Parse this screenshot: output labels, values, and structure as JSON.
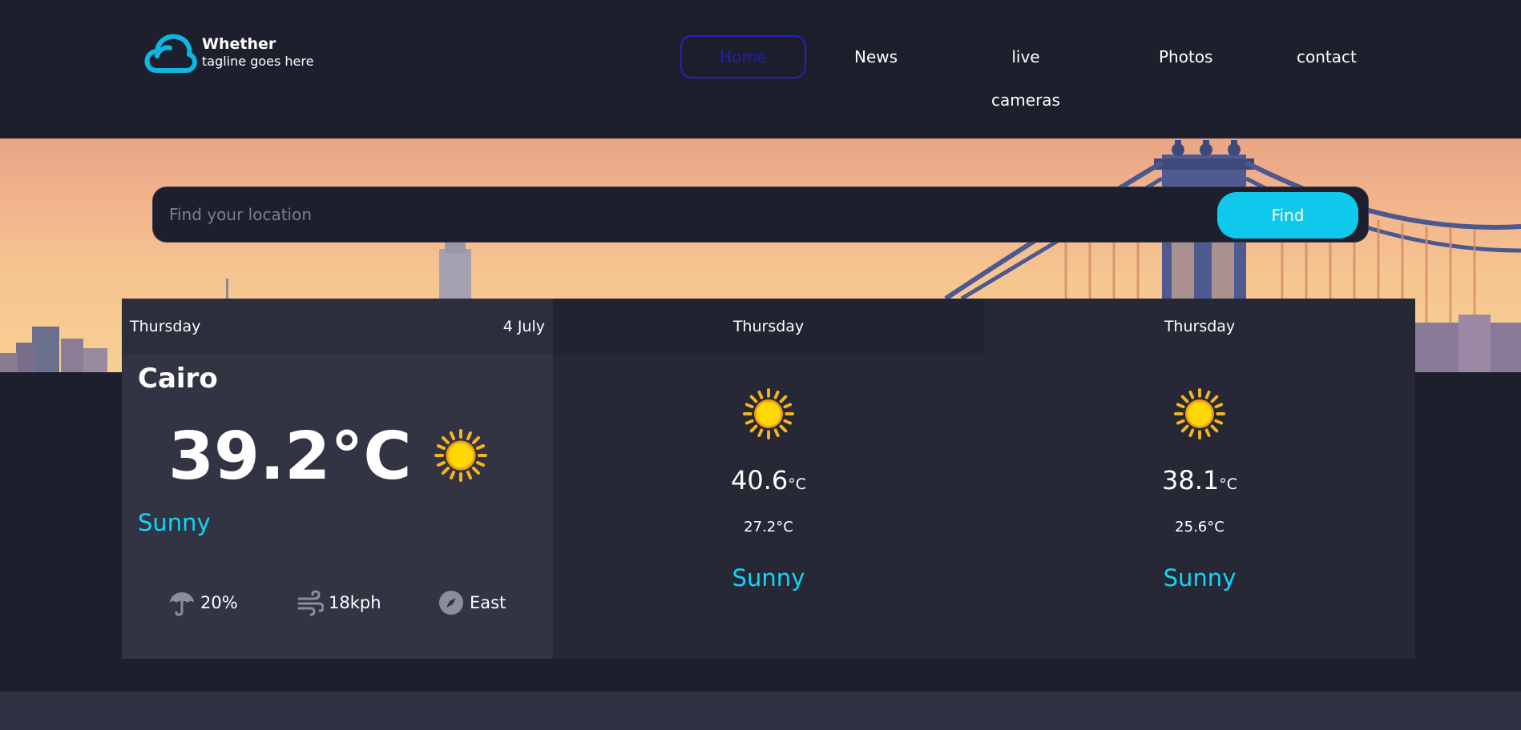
{
  "brand": {
    "name": "Whether",
    "tagline": "tagline goes here",
    "logo_icon": "cloud-icon",
    "logo_color": "#0fb6e0"
  },
  "nav": {
    "items": [
      "Home",
      "News",
      "live cameras",
      "Photos",
      "contact"
    ],
    "active": "Home",
    "active_color": "#1d25c4"
  },
  "search": {
    "placeholder": "Find your location",
    "value": "",
    "button_label": "Find",
    "button_color": "#0fc9ec"
  },
  "forecast": {
    "today": {
      "day": "Thursday",
      "date": "4 July",
      "city": "Cairo",
      "temperature": "39.2°C",
      "icon": "sun-icon",
      "condition": "Sunny",
      "rain": "20%",
      "wind": "18kph",
      "direction": "East"
    },
    "next": [
      {
        "day": "Thursday",
        "icon": "sun-icon",
        "max": "40.6",
        "unit": "°C",
        "min": "27.2°C",
        "condition": "Sunny"
      },
      {
        "day": "Thursday",
        "icon": "sun-icon",
        "max": "38.1",
        "unit": "°C",
        "min": "25.6°C",
        "condition": "Sunny"
      }
    ]
  },
  "colors": {
    "background": "#1e1f2c",
    "card_today": "#323444",
    "card": "#262836",
    "condition": "#0fd7f5"
  },
  "stat_icons": [
    "umbrella-icon",
    "wind-icon",
    "compass-icon"
  ]
}
